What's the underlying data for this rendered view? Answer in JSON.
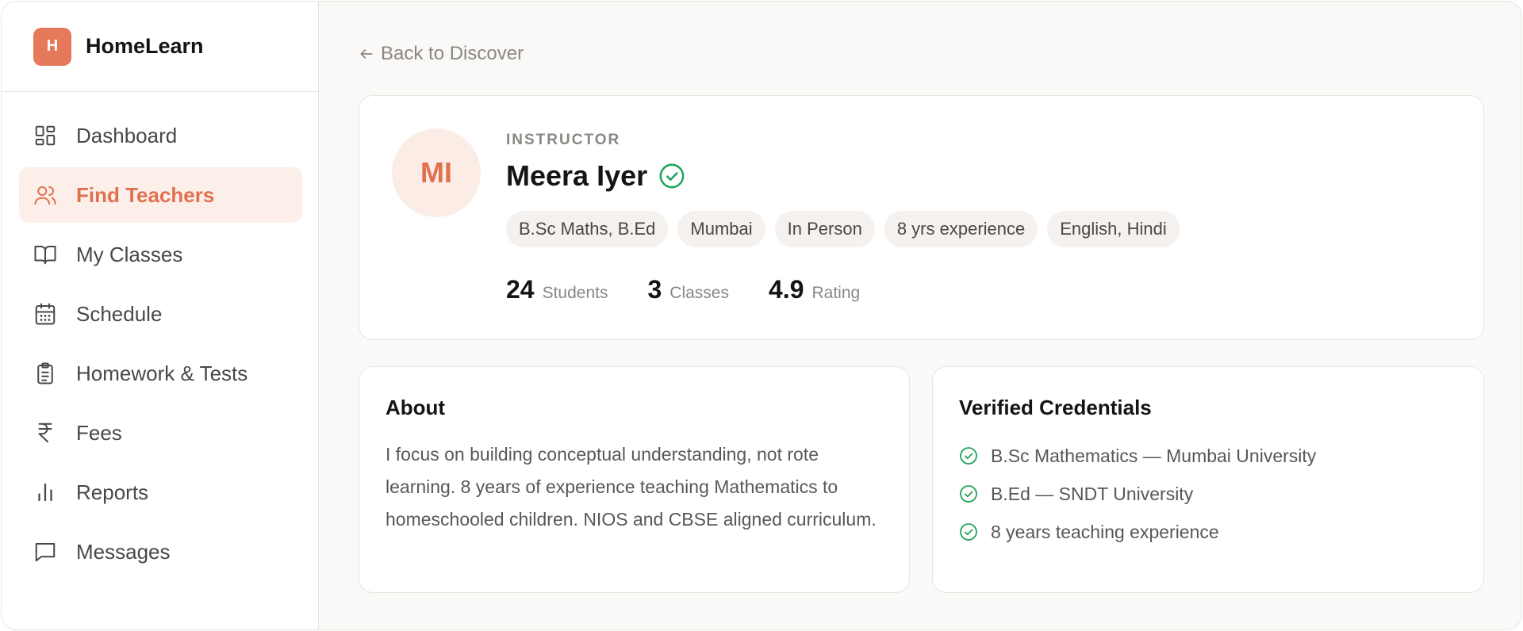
{
  "brand": {
    "logo_letter": "H",
    "name": "HomeLearn",
    "accent": "#e5795a"
  },
  "sidebar": {
    "items": [
      {
        "label": "Dashboard",
        "icon": "dashboard-icon",
        "active": false
      },
      {
        "label": "Find Teachers",
        "icon": "users-icon",
        "active": true
      },
      {
        "label": "My Classes",
        "icon": "book-open-icon",
        "active": false
      },
      {
        "label": "Schedule",
        "icon": "calendar-icon",
        "active": false
      },
      {
        "label": "Homework & Tests",
        "icon": "clipboard-icon",
        "active": false
      },
      {
        "label": "Fees",
        "icon": "rupee-icon",
        "active": false
      },
      {
        "label": "Reports",
        "icon": "bar-chart-icon",
        "active": false
      },
      {
        "label": "Messages",
        "icon": "message-square-icon",
        "active": false
      }
    ]
  },
  "main": {
    "back_label": "Back to Discover",
    "profile": {
      "avatar_initials": "MI",
      "role": "INSTRUCTOR",
      "name": "Meera Iyer",
      "verified": true,
      "chips": [
        "B.Sc Maths, B.Ed",
        "Mumbai",
        "In Person",
        "8 yrs experience",
        "English, Hindi"
      ],
      "stats": [
        {
          "value": "24",
          "label": "Students"
        },
        {
          "value": "3",
          "label": "Classes"
        },
        {
          "value": "4.9",
          "label": "Rating"
        }
      ]
    },
    "about": {
      "title": "About",
      "text": "I focus on building conceptual understanding, not rote learning. 8 years of experience teaching Mathematics to homeschooled children. NIOS and CBSE aligned curriculum."
    },
    "credentials": {
      "title": "Verified Credentials",
      "items": [
        "B.Sc Mathematics — Mumbai University",
        "B.Ed — SNDT University",
        "8 years teaching experience"
      ]
    }
  },
  "colors": {
    "accent": "#e0714f",
    "active_bg": "#fcefea",
    "verified": "#22a35a"
  }
}
